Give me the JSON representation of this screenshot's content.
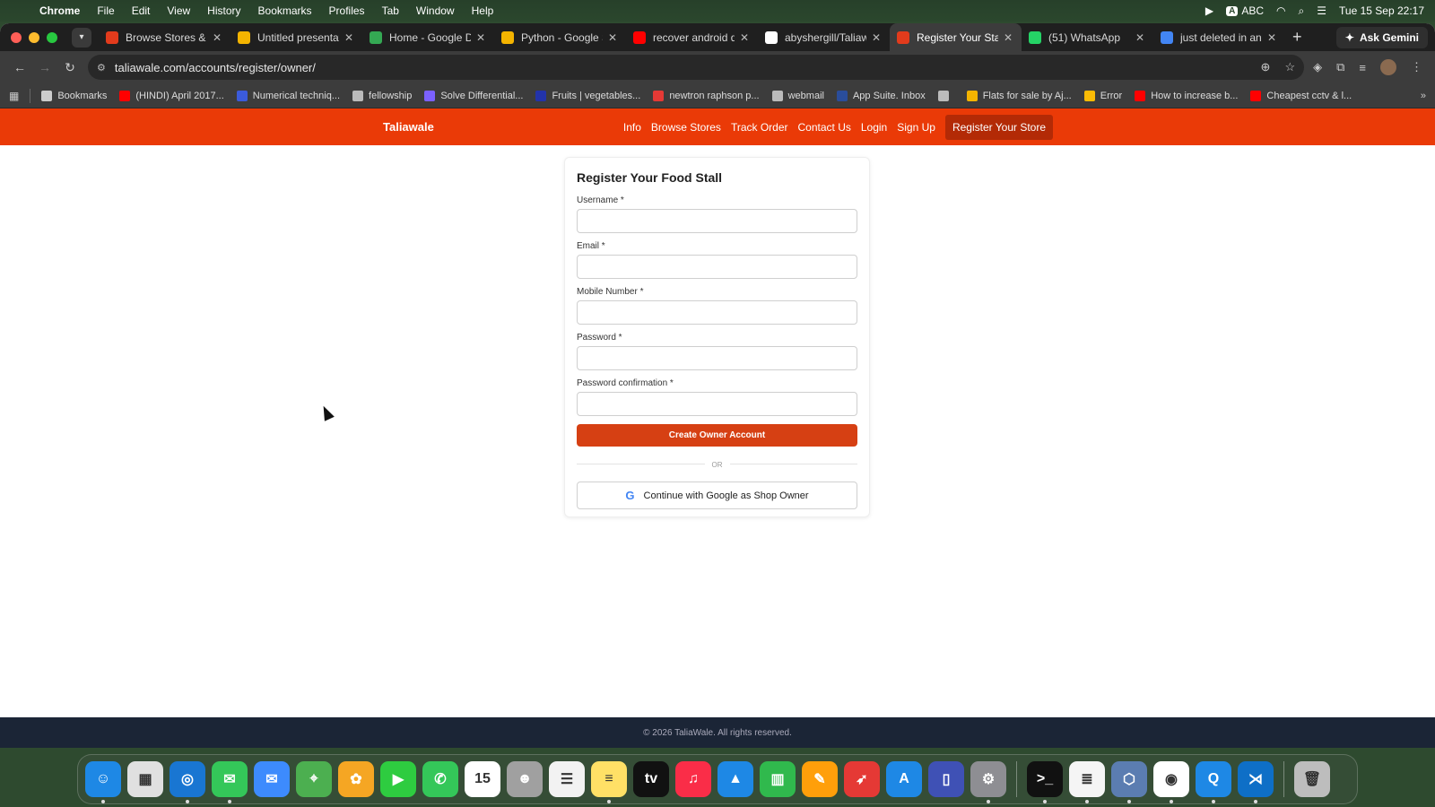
{
  "menubar": {
    "app": "Chrome",
    "items": [
      "File",
      "Edit",
      "View",
      "History",
      "Bookmarks",
      "Profiles",
      "Tab",
      "Window",
      "Help"
    ],
    "input_badge": "A",
    "input_source": "ABC",
    "datetime": "Tue 15 Sep  22:17"
  },
  "tabs": [
    {
      "title": "Browse Stores & It",
      "color": "#e23b1c",
      "active": false
    },
    {
      "title": "Untitled presentati",
      "color": "#f4b400",
      "active": false
    },
    {
      "title": "Home - Google Dri",
      "color": "#34a853",
      "active": false
    },
    {
      "title": "Python - Google Sl",
      "color": "#f4b400",
      "active": false
    },
    {
      "title": "recover android de",
      "color": "#ff0000",
      "active": false
    },
    {
      "title": "abyshergill/Taliawa",
      "color": "#ffffff",
      "active": false
    },
    {
      "title": "Register Your Stall",
      "color": "#e23b1c",
      "active": true
    },
    {
      "title": "(51) WhatsApp",
      "color": "#25d366",
      "active": false
    },
    {
      "title": "just deleted in ann",
      "color": "#4285f4",
      "active": false
    }
  ],
  "ask_gemini": "Ask Gemini",
  "omnibox": {
    "url": "taliawale.com/accounts/register/owner/"
  },
  "bookmarks": [
    {
      "label": "Bookmarks",
      "color": "#cccccc"
    },
    {
      "label": "(HINDI) April 2017...",
      "color": "#ff0000"
    },
    {
      "label": "Numerical techniq...",
      "color": "#3b5bdb"
    },
    {
      "label": "fellowship",
      "color": "#bbbbbb"
    },
    {
      "label": "Solve Differential...",
      "color": "#7b61ff"
    },
    {
      "label": "Fruits | vegetables...",
      "color": "#2233aa"
    },
    {
      "label": "newtron raphson p...",
      "color": "#e53935"
    },
    {
      "label": "webmail",
      "color": "#bbbbbb"
    },
    {
      "label": "App Suite. Inbox",
      "color": "#2a4d9b"
    },
    {
      "label": "",
      "color": "#bbbbbb"
    },
    {
      "label": "Flats for sale by Aj...",
      "color": "#f4b400"
    },
    {
      "label": "Error",
      "color": "#fbbc05"
    },
    {
      "label": "How to increase b...",
      "color": "#ff0000"
    },
    {
      "label": "Cheapest cctv & l...",
      "color": "#ff0000"
    }
  ],
  "site": {
    "brand": "Taliawale",
    "nav": [
      "Info",
      "Browse Stores",
      "Track Order",
      "Contact Us",
      "Login",
      "Sign Up"
    ],
    "cta": "Register Your Store",
    "accent": "#ea3a07"
  },
  "form": {
    "title": "Register Your Food Stall",
    "fields": [
      {
        "label": "Username *",
        "value": ""
      },
      {
        "label": "Email *",
        "value": ""
      },
      {
        "label": "Mobile Number *",
        "value": ""
      },
      {
        "label": "Password *",
        "value": ""
      },
      {
        "label": "Password confirmation *",
        "value": ""
      }
    ],
    "submit": "Create Owner Account",
    "divider": "OR",
    "google": "Continue with Google as Shop Owner",
    "google_logo": "G"
  },
  "footer": "© 2026 TaliaWale. All rights reserved.",
  "dock": [
    {
      "name": "finder",
      "color": "#1e88e5",
      "glyph": "☺",
      "running": true
    },
    {
      "name": "launchpad",
      "color": "#e0e0e0",
      "glyph": "▦",
      "running": false
    },
    {
      "name": "safari",
      "color": "#1976d2",
      "glyph": "◎",
      "running": true
    },
    {
      "name": "messages",
      "color": "#34c759",
      "glyph": "✉",
      "running": true
    },
    {
      "name": "mail",
      "color": "#3d8bfd",
      "glyph": "✉",
      "running": false
    },
    {
      "name": "maps",
      "color": "#4caf50",
      "glyph": "⌖",
      "running": false
    },
    {
      "name": "photos",
      "color": "#f5a623",
      "glyph": "✿",
      "running": false
    },
    {
      "name": "facetime",
      "color": "#2ecc40",
      "glyph": "▶",
      "running": false
    },
    {
      "name": "phone",
      "color": "#34c759",
      "glyph": "✆",
      "running": false
    },
    {
      "name": "calendar",
      "color": "#ffffff",
      "glyph": "15",
      "running": false
    },
    {
      "name": "contacts",
      "color": "#a0a0a0",
      "glyph": "☻",
      "running": false
    },
    {
      "name": "reminders",
      "color": "#f2f2f2",
      "glyph": "☰",
      "running": false
    },
    {
      "name": "notes",
      "color": "#ffe066",
      "glyph": "≡",
      "running": true
    },
    {
      "name": "tv",
      "color": "#111111",
      "glyph": "tv",
      "running": false
    },
    {
      "name": "music",
      "color": "#fa2d48",
      "glyph": "♫",
      "running": false
    },
    {
      "name": "keynote",
      "color": "#1e88e5",
      "glyph": "▲",
      "running": false
    },
    {
      "name": "numbers",
      "color": "#30b94d",
      "glyph": "▥",
      "running": false
    },
    {
      "name": "pages",
      "color": "#ff9f0a",
      "glyph": "✎",
      "running": false
    },
    {
      "name": "rocket",
      "color": "#e53935",
      "glyph": "➶",
      "running": false
    },
    {
      "name": "app-store",
      "color": "#1e88e5",
      "glyph": "A",
      "running": false
    },
    {
      "name": "simulator",
      "color": "#3f51b5",
      "glyph": "▯",
      "running": false
    },
    {
      "name": "system-settings",
      "color": "#8e8e93",
      "glyph": "⚙",
      "running": true
    },
    {
      "name": "terminal",
      "color": "#111111",
      "glyph": ">_",
      "running": true
    },
    {
      "name": "textedit",
      "color": "#f5f5f5",
      "glyph": "≣",
      "running": true
    },
    {
      "name": "backup",
      "color": "#5b7db1",
      "glyph": "⬡",
      "running": true
    },
    {
      "name": "chrome",
      "color": "#ffffff",
      "glyph": "◉",
      "running": true
    },
    {
      "name": "quicktime",
      "color": "#1e88e5",
      "glyph": "Q",
      "running": true
    },
    {
      "name": "vscode",
      "color": "#0e6fc7",
      "glyph": "⋊",
      "running": true
    },
    {
      "name": "trash",
      "color": "#bdbdbd",
      "glyph": "🗑",
      "running": false
    }
  ]
}
